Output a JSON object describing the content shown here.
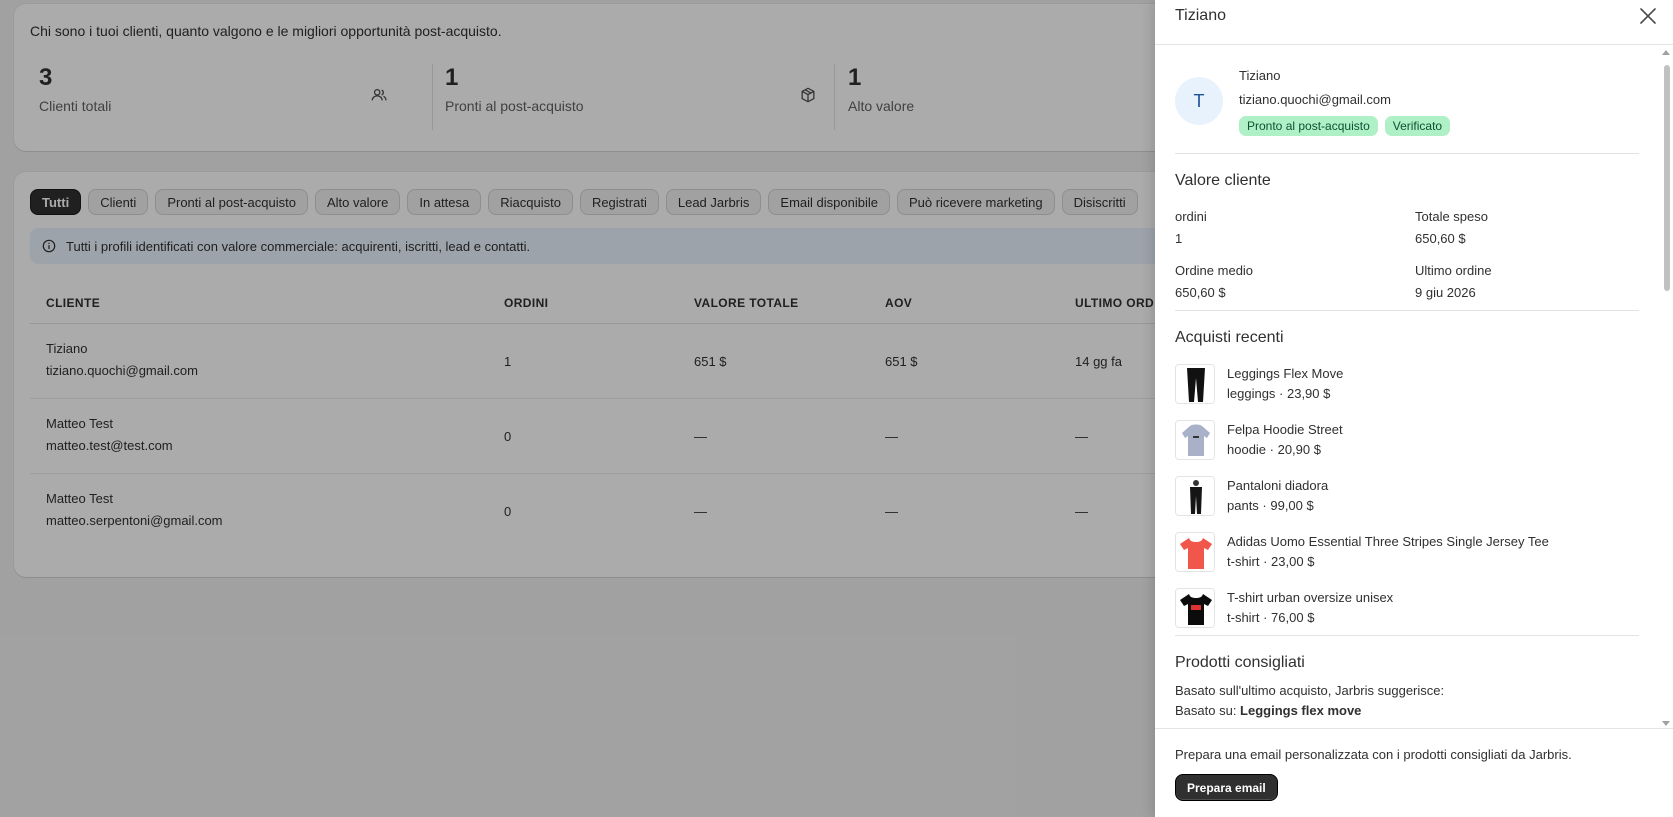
{
  "header": {
    "subtitle": "Chi sono i tuoi clienti, quanto valgono e le migliori opportunità post-acquisto."
  },
  "stats": [
    {
      "value": "3",
      "label": "Clienti totali",
      "icon": "users-icon"
    },
    {
      "value": "1",
      "label": "Pronti al post-acquisto",
      "icon": "package-icon"
    },
    {
      "value": "1",
      "label": "Alto valore"
    }
  ],
  "tabs": [
    {
      "label": "Tutti",
      "active": true
    },
    {
      "label": "Clienti"
    },
    {
      "label": "Pronti al post-acquisto"
    },
    {
      "label": "Alto valore"
    },
    {
      "label": "In attesa"
    },
    {
      "label": "Riacquisto"
    },
    {
      "label": "Registrati"
    },
    {
      "label": "Lead Jarbris"
    },
    {
      "label": "Email disponibile"
    },
    {
      "label": "Può ricevere marketing"
    },
    {
      "label": "Disiscritti"
    }
  ],
  "banner": {
    "text": "Tutti i profili identificati con valore commerciale: acquirenti, iscritti, lead e contatti."
  },
  "table": {
    "columns": [
      "CLIENTE",
      "ORDINI",
      "VALORE TOTALE",
      "AOV",
      "ULTIMO ORD"
    ],
    "rows": [
      {
        "name": "Tiziano",
        "email": "tiziano.quochi@gmail.com",
        "orders": "1",
        "total": "651 $",
        "aov": "651 $",
        "last": "14 gg fa"
      },
      {
        "name": "Matteo Test",
        "email": "matteo.test@test.com",
        "orders": "0",
        "total": "—",
        "aov": "—",
        "last": "—"
      },
      {
        "name": "Matteo Test",
        "email": "matteo.serpentoni@gmail.com",
        "orders": "0",
        "total": "—",
        "aov": "—",
        "last": "—"
      }
    ]
  },
  "panel": {
    "title": "Tiziano",
    "profile": {
      "initial": "T",
      "name": "Tiziano",
      "email": "tiziano.quochi@gmail.com",
      "badges": [
        "Pronto al post-acquisto",
        "Verificato"
      ]
    },
    "value_section": {
      "title": "Valore cliente",
      "orders_label": "ordini",
      "orders_value": "1",
      "total_label": "Totale speso",
      "total_value": "650,60 $",
      "aov_label": "Ordine medio",
      "aov_value": "650,60 $",
      "last_label": "Ultimo ordine",
      "last_value": "9 giu 2026"
    },
    "purchases_section": {
      "title": "Acquisti recenti",
      "items": [
        {
          "name": "Leggings Flex Move",
          "meta": "leggings · 23,90 $",
          "color": "#111111",
          "kind": "leggings"
        },
        {
          "name": "Felpa Hoodie Street",
          "meta": "hoodie · 20,90 $",
          "color": "#a9b1c9",
          "kind": "hoodie"
        },
        {
          "name": "Pantaloni diadora",
          "meta": "pants · 99,00 $",
          "color": "#151515",
          "kind": "pants"
        },
        {
          "name": "Adidas Uomo Essential Three Stripes Single Jersey Tee",
          "meta": "t-shirt · 23,00 $",
          "color": "#f0564a",
          "kind": "tshirt"
        },
        {
          "name": "T-shirt urban oversize unisex",
          "meta": "t-shirt · 76,00 $",
          "color": "#0c0c0c",
          "kind": "tshirt-print"
        }
      ]
    },
    "recommended_section": {
      "title": "Prodotti consigliati",
      "line1": "Basato sull'ultimo acquisto, Jarbris suggerisce:",
      "line2_prefix": "Basato su: ",
      "line2_bold": "Leggings flex move"
    },
    "footer": {
      "text": "Prepara una email personalizzata con i prodotti consigliati da Jarbris.",
      "button": "Prepara email"
    }
  }
}
